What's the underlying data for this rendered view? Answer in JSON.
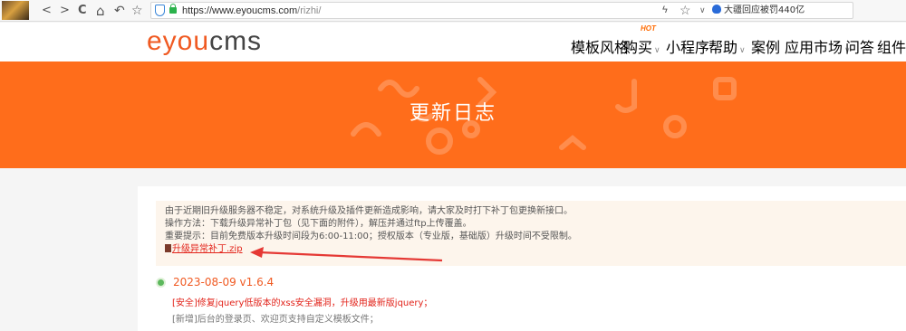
{
  "browser": {
    "nav_back": "<",
    "nav_forward": ">",
    "nav_reload": "C",
    "nav_home": "⌂",
    "nav_undo": "↶",
    "nav_star": "☆",
    "url_host": "https://www.eyoucms.com",
    "url_path": "/rizhi/",
    "right_bolt": "ϟ",
    "right_star": "☆",
    "right_dropdown": "∨",
    "search_hint": "大疆回应被罚440亿"
  },
  "site": {
    "logo_part1": "eyou",
    "logo_part2": "cms",
    "hot_badge": "HOT",
    "nav": [
      {
        "label": "模板风格",
        "has_caret": false
      },
      {
        "label": "购买",
        "has_caret": true
      },
      {
        "label": "小程序",
        "has_caret": false
      },
      {
        "label": "帮助",
        "has_caret": true
      },
      {
        "label": "案例",
        "has_caret": false
      },
      {
        "label": "应用市场",
        "has_caret": true
      },
      {
        "label": "问答",
        "has_caret": false
      },
      {
        "label": "组件库",
        "has_caret": false
      }
    ],
    "caret": "∨"
  },
  "banner": {
    "title": "更新日志",
    "accent_color": "#ff6d1b"
  },
  "notice": {
    "line1": "由于近期旧升级服务器不稳定，对系统升级及插件更新造成影响，请大家及时打下补丁包更换新接口。",
    "line2": "操作方法：下载升级异常补丁包（见下面的附件），解压并通过ftp上传覆盖。",
    "line3": "重要提示：目前免费版本升级时间段为6:00-11:00；授权版本（专业版，基础版）升级时间不受限制。",
    "download_link": "升级异常补丁.zip"
  },
  "log": {
    "version": "2023-08-09 v1.6.4",
    "security_line": "[安全]修复jquery低版本的xss安全漏洞，升级用最新版jquery；",
    "new_line": "[新增]后台的登录页、欢迎页支持自定义模板文件；"
  }
}
